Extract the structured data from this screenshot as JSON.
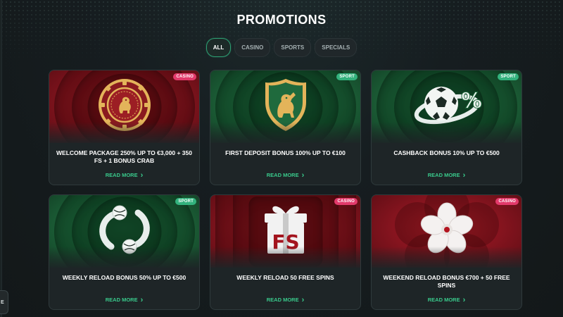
{
  "page": {
    "title": "PROMOTIONS"
  },
  "side_tab": {
    "label": "E"
  },
  "filters": [
    {
      "label": "ALL",
      "active": true
    },
    {
      "label": "CASINO",
      "active": false
    },
    {
      "label": "SPORTS",
      "active": false
    },
    {
      "label": "SPECIALS",
      "active": false
    }
  ],
  "cards": [
    {
      "badge": "CASINO",
      "badge_type": "casino",
      "theme": "red",
      "icon": "casino-chip-lion-icon",
      "title": "WELCOME PACKAGE 250% UP TO €3,000 + 350 FS + 1 BONUS CRAB",
      "cta": "READ MORE"
    },
    {
      "badge": "SPORT",
      "badge_type": "sport",
      "theme": "green",
      "icon": "lion-shield-icon",
      "title": "FIRST DEPOSIT BONUS 100% UP TO €100",
      "cta": "READ MORE"
    },
    {
      "badge": "SPORT",
      "badge_type": "sport",
      "theme": "green",
      "icon": "soccer-ball-percent-icon",
      "title": "CASHBACK BONUS 10% UP TO €500",
      "cta": "READ MORE"
    },
    {
      "badge": "SPORT",
      "badge_type": "sport",
      "theme": "green",
      "icon": "reload-balls-icon",
      "title": "WEEKLY RELOAD BONUS 50% UP TO €500",
      "cta": "READ MORE"
    },
    {
      "badge": "CASINO",
      "badge_type": "casino",
      "theme": "red",
      "icon": "gift-box-fs-icon",
      "title": "WEEKLY RELOAD 50 FREE SPINS",
      "cta": "READ MORE"
    },
    {
      "badge": "CASINO",
      "badge_type": "casino",
      "theme": "red",
      "icon": "flower-icon",
      "title": "WEEKEND RELOAD BONUS €700 + 50 FREE SPINS",
      "cta": "READ MORE"
    }
  ],
  "colors": {
    "accent": "#39c98b",
    "casino_badge": "#e23a6b",
    "sport_badge": "#33b27d",
    "background": "#161d20"
  }
}
